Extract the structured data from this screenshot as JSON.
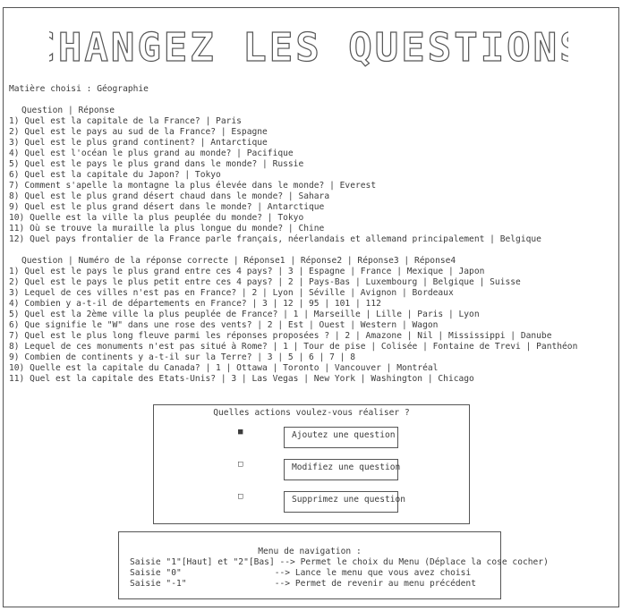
{
  "banner_text": "CHANGEZ LES QUESTIONS",
  "subject_line": "Matière choisi : Géographie",
  "open_questions": {
    "header": "Question | Réponse",
    "rows": [
      "1) Quel est la capitale de la France? | Paris",
      "2) Quel est le pays au sud de la France? | Espagne",
      "3) Quel est le plus grand continent? | Antarctique",
      "4) Quel est l'océan le plus grand au monde? | Pacifique",
      "5) Quel est le pays le plus grand dans le monde? | Russie",
      "6) Quel est la capitale du Japon? | Tokyo",
      "7) Comment s'apelle la montagne la plus élevée dans le monde? | Everest",
      "8) Quel est le plus grand désert chaud dans le monde? | Sahara",
      "9) Quel est le plus grand désert dans le monde? | Antarctique",
      "10) Quelle est la ville la plus peuplée du monde? | Tokyo",
      "11) Où se trouve la muraille la plus longue du monde? | Chine",
      "12) Quel pays frontalier de la France parle français, néerlandais et allemand principalement | Belgique"
    ]
  },
  "mcq_questions": {
    "header": "Question | Numéro de la réponse correcte | Réponse1 | Réponse2 | Réponse3 | Réponse4",
    "rows": [
      "1) Quel est le pays le plus grand entre ces 4 pays? | 3 | Espagne | France | Mexique | Japon",
      "2) Quel est le pays le plus petit entre ces 4 pays? | 2 | Pays-Bas | Luxembourg | Belgique | Suisse",
      "3) Lequel de ces villes n'est pas en France? | 2 | Lyon | Séville | Avignon | Bordeaux",
      "4) Combien y a-t-il de départements en France? | 3 | 12 | 95 | 101 | 112",
      "5) Quel est la 2ème ville la plus peuplée de France? | 1 | Marseille | Lille | Paris | Lyon",
      "6) Que signifie le \"W\" dans une rose des vents? | 2 | Est | Ouest | Western | Wagon",
      "7) Quel est le plus long fleuve parmi les réponses proposées ? | 2 | Amazone | Nil | Mississippi | Danube",
      "8) Lequel de ces monuments n'est pas situé à Rome? | 1 | Tour de pise | Colisée | Fontaine de Trevi | Panthéon",
      "9) Combien de continents y a-t-il sur la Terre? | 3 | 5 | 6 | 7 | 8",
      "10) Quelle est la capitale du Canada? | 1 | Ottawa | Toronto | Vancouver | Montréal",
      "11) Quel est la capitale des Etats-Unis? | 3 | Las Vegas | New York | Washington | Chicago"
    ]
  },
  "action_menu": {
    "title": "Quelles actions voulez-vous réaliser ?",
    "options": [
      {
        "label": "Ajoutez une question",
        "marker": "■",
        "selected": true
      },
      {
        "label": "Modifiez une question",
        "marker": "□",
        "selected": false
      },
      {
        "label": "Supprimez une question",
        "marker": "□",
        "selected": false
      }
    ]
  },
  "navigation": {
    "title": "Menu de navigation :",
    "lines": [
      "Saisie \"1\"[Haut] et \"2\"[Bas] --> Permet le choix du Menu (Déplace la cose cocher)",
      "Saisie \"0\"                  --> Lance le menu que vous avez choisi",
      "Saisie \"-1\"                 --> Permet de revenir au menu précédent"
    ]
  }
}
